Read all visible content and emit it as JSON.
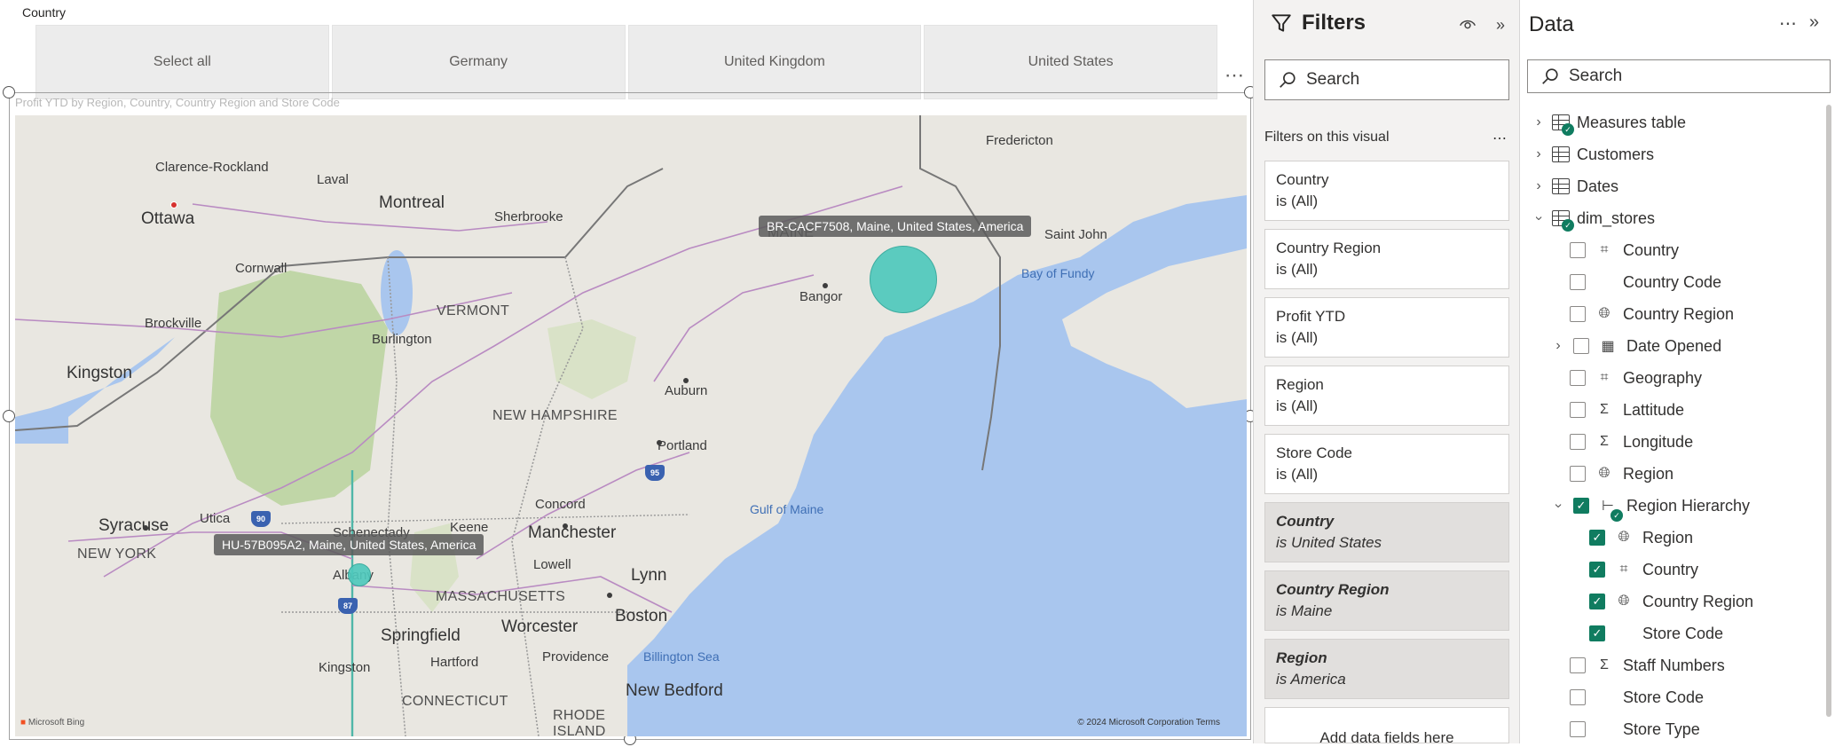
{
  "slicer": {
    "title": "Country",
    "options": [
      "Select all",
      "Germany",
      "United Kingdom",
      "United States"
    ]
  },
  "visual": {
    "title": "Profit YTD by Region, Country, Country Region and Store Code",
    "more": "⋯",
    "attribution": "Microsoft Bing",
    "copyright": "© 2024 Microsoft Corporation  Terms",
    "tooltips": [
      "BR-CACF7508, Maine, United States, America",
      "HU-57B095A2, Maine, United States, America"
    ],
    "labels": {
      "ottawa": "Ottawa",
      "clarence": "Clarence-Rockland",
      "laval": "Laval",
      "montreal": "Montreal",
      "sherbrooke": "Sherbrooke",
      "cornwall": "Cornwall",
      "brockville": "Brockville",
      "kingston_on": "Kingston",
      "vermont": "VERMONT",
      "burlington": "Burlington",
      "maine": "MAINE",
      "bangor": "Bangor",
      "fredericton": "Fredericton",
      "saint_john": "Saint John",
      "bay_of_fundy": "Bay of Fundy",
      "auburn": "Auburn",
      "new_hampshire": "NEW HAMPSHIRE",
      "portland": "Portland",
      "gulf_of_maine": "Gulf of Maine",
      "syracuse": "Syracuse",
      "utica": "Utica",
      "schenectady": "Schenectady",
      "keene": "Keene",
      "concord": "Concord",
      "manchester": "Manchester",
      "new_york": "NEW YORK",
      "albany": "Albany",
      "lowell": "Lowell",
      "lynn": "Lynn",
      "massachusetts": "MASSACHUSETTS",
      "boston": "Boston",
      "springfield": "Springfield",
      "worcester": "Worcester",
      "kingston_ny": "Kingston",
      "hartford": "Hartford",
      "providence": "Providence",
      "billington": "Billington Sea",
      "connecticut": "CONNECTICUT",
      "rhode_island": "RHODE ISLAND",
      "new_bedford": "New Bedford",
      "hwy_90": "90",
      "hwy_87": "87",
      "hwy_95": "95"
    }
  },
  "filters": {
    "title": "Filters",
    "search_placeholder": "Search",
    "section_title": "Filters on this visual",
    "more": "⋯",
    "cards": [
      {
        "name": "Country",
        "value": "is (All)"
      },
      {
        "name": "Country Region",
        "value": "is (All)"
      },
      {
        "name": "Profit YTD",
        "value": "is (All)"
      },
      {
        "name": "Region",
        "value": "is (All)"
      },
      {
        "name": "Store Code",
        "value": "is (All)"
      },
      {
        "name": "Country",
        "value": "is United States"
      },
      {
        "name": "Country Region",
        "value": "is Maine"
      },
      {
        "name": "Region",
        "value": "is America"
      }
    ],
    "add_label": "Add data fields here"
  },
  "data_pane": {
    "title": "Data",
    "search_placeholder": "Search",
    "tables": [
      "Measures table",
      "Customers",
      "Dates",
      "dim_stores"
    ],
    "fields": [
      "Country",
      "Country Code",
      "Country Region",
      "Date Opened",
      "Geography",
      "Lattitude",
      "Longitude",
      "Region",
      "Region Hierarchy"
    ],
    "hierarchy_levels": [
      "Region",
      "Country",
      "Country Region",
      "Store Code"
    ],
    "fields_after": [
      "Staff Numbers",
      "Store Code",
      "Store Type"
    ]
  }
}
